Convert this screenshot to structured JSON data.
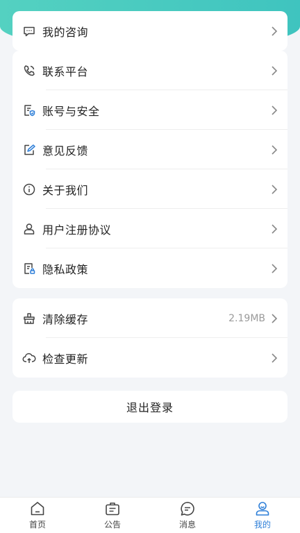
{
  "colors": {
    "accent": "#2e7fd8",
    "banner": "#4ccbc0",
    "icon": "#444444"
  },
  "group1": {
    "items": [
      {
        "label": "我的咨询",
        "icon": "chat-bubble-icon"
      }
    ]
  },
  "group2": {
    "items": [
      {
        "label": "联系平台",
        "icon": "phone-icon"
      },
      {
        "label": "账号与安全",
        "icon": "shield-document-icon"
      },
      {
        "label": "意见反馈",
        "icon": "edit-icon"
      },
      {
        "label": "关于我们",
        "icon": "info-icon"
      },
      {
        "label": "用户注册协议",
        "icon": "user-icon"
      },
      {
        "label": "隐私政策",
        "icon": "privacy-document-icon"
      }
    ]
  },
  "group3": {
    "items": [
      {
        "label": "清除缓存",
        "value": "2.19MB",
        "icon": "broom-icon"
      },
      {
        "label": "检查更新",
        "icon": "cloud-upload-icon"
      }
    ]
  },
  "logout": {
    "label": "退出登录"
  },
  "tabbar": {
    "active": "我的",
    "items": [
      {
        "label": "首页",
        "icon": "home-icon"
      },
      {
        "label": "公告",
        "icon": "notice-icon"
      },
      {
        "label": "消息",
        "icon": "message-icon"
      },
      {
        "label": "我的",
        "icon": "profile-icon"
      }
    ]
  }
}
